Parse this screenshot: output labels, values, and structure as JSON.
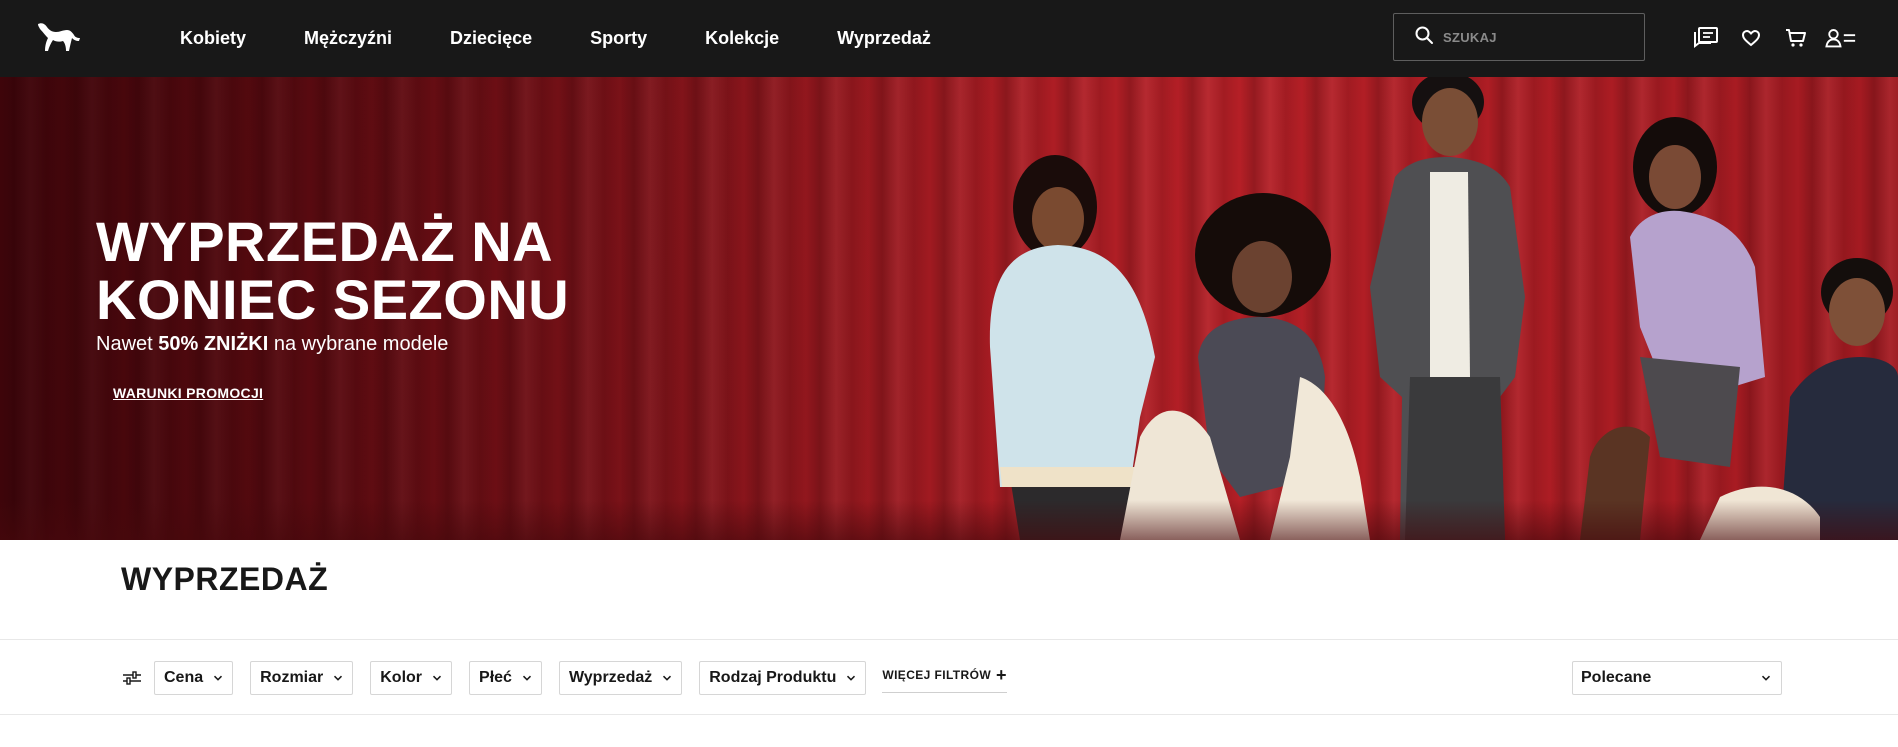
{
  "header": {
    "logo": "puma-logo",
    "nav": [
      {
        "label": "Kobiety"
      },
      {
        "label": "Mężczyźni"
      },
      {
        "label": "Dziecięce"
      },
      {
        "label": "Sporty"
      },
      {
        "label": "Kolekcje"
      },
      {
        "label": "Wyprzedaż"
      }
    ],
    "search": {
      "placeholder": "SZUKAJ",
      "value": ""
    },
    "icons": [
      "chat-icon",
      "heart-icon",
      "cart-icon",
      "account-icon"
    ]
  },
  "hero": {
    "title": "WYPRZEDAŻ NA KONIEC SEZONU",
    "subtitle_prefix": "Nawet ",
    "subtitle_bold": "50% ZNIŻKI",
    "subtitle_suffix": " na wybrane modele",
    "link": "WARUNKI PROMOCJI",
    "background_color": "#a51b22"
  },
  "page": {
    "title": "WYPRZEDAŻ"
  },
  "filters": {
    "items": [
      {
        "label": "Cena"
      },
      {
        "label": "Rozmiar"
      },
      {
        "label": "Kolor"
      },
      {
        "label": "Płeć"
      },
      {
        "label": "Wyprzedaż"
      },
      {
        "label": "Rodzaj Produktu"
      }
    ],
    "more_label": "WIĘCEJ FILTRÓW",
    "more_icon": "plus",
    "sort": {
      "selected": "Polecane"
    }
  },
  "colors": {
    "header_bg": "#181818",
    "hero_red": "#a51b22",
    "text": "#181818"
  }
}
